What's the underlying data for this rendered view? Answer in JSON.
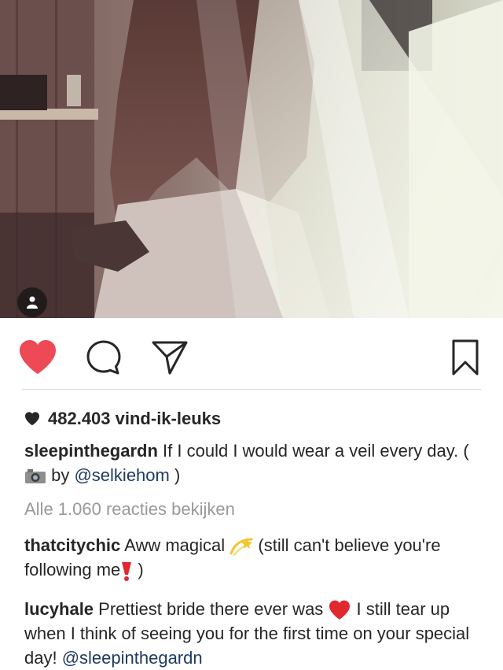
{
  "post": {
    "image_alt": "Bride with long hair wearing a white veil",
    "likes_text": "482.403 vind-ik-leuks",
    "caption": {
      "username": "sleepinthegardn",
      "text_part1": "If I could I would wear a veil every day. (",
      "text_part2": " by ",
      "mention": "@selkiehom",
      "text_part3": " )"
    },
    "view_all_comments": "Alle 1.060 reacties bekijken",
    "comments": [
      {
        "username": "thatcitychic",
        "text_part1": "Aww magical ",
        "emoji1": "dizzy-emoji",
        "text_part2": "  (still can't believe you're following me",
        "emoji2": "heavy-exclamation-emoji",
        "text_part3": " )"
      },
      {
        "username": "lucyhale",
        "text_part1": "Prettiest bride there ever was ",
        "emoji1": "red-heart-emoji",
        "text_part2": "  I still tear up when I think of seeing you for the first time on your special day!  ",
        "mention": "@sleepinthegardn"
      }
    ]
  },
  "actions": {
    "like_icon": "heart-icon",
    "comment_icon": "comment-bubble-icon",
    "share_icon": "paper-plane-icon",
    "save_icon": "bookmark-icon",
    "liked": true
  },
  "colors": {
    "heart_red": "#ed4956",
    "mention_blue": "#1e3a61",
    "muted_gray": "#999999",
    "text_dark": "#262626"
  }
}
